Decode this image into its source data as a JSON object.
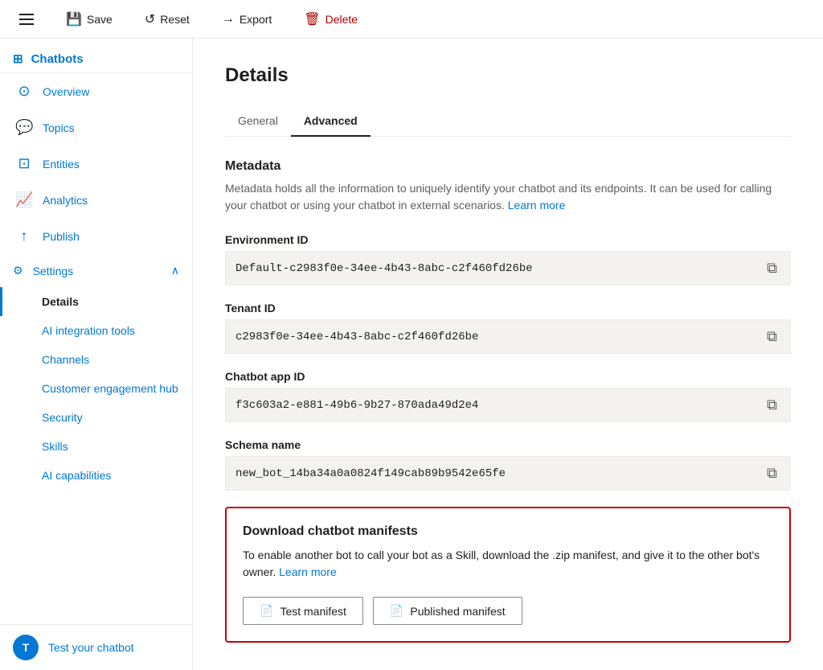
{
  "toolbar": {
    "save_label": "Save",
    "reset_label": "Reset",
    "export_label": "Export",
    "delete_label": "Delete"
  },
  "sidebar": {
    "app_name": "Chatbots",
    "items": [
      {
        "id": "chatbots",
        "label": "Chatbots",
        "icon": "⊞"
      },
      {
        "id": "overview",
        "label": "Overview",
        "icon": "⊙"
      },
      {
        "id": "topics",
        "label": "Topics",
        "icon": "💬"
      },
      {
        "id": "entities",
        "label": "Entities",
        "icon": "⊡"
      },
      {
        "id": "analytics",
        "label": "Analytics",
        "icon": "📈"
      },
      {
        "id": "publish",
        "label": "Publish",
        "icon": "↑"
      }
    ],
    "settings_label": "Settings",
    "settings_icon": "⚙",
    "sub_items": [
      {
        "id": "details",
        "label": "Details"
      },
      {
        "id": "ai-integration",
        "label": "AI integration tools"
      },
      {
        "id": "channels",
        "label": "Channels"
      },
      {
        "id": "customer-engagement",
        "label": "Customer engagement hub"
      },
      {
        "id": "security",
        "label": "Security"
      },
      {
        "id": "skills",
        "label": "Skills"
      },
      {
        "id": "ai-capabilities",
        "label": "AI capabilities"
      }
    ],
    "bottom_item": "Test your chatbot",
    "avatar_initials": "T"
  },
  "page": {
    "title": "Details",
    "tabs": [
      {
        "id": "general",
        "label": "General"
      },
      {
        "id": "advanced",
        "label": "Advanced"
      }
    ],
    "active_tab": "advanced"
  },
  "metadata": {
    "title": "Metadata",
    "description": "Metadata holds all the information to uniquely identify your chatbot and its endpoints. It can be used for calling your chatbot or using your chatbot in external scenarios.",
    "learn_more_link": "Learn more",
    "fields": [
      {
        "id": "environment-id",
        "label": "Environment ID",
        "value": "Default-c2983f0e-34ee-4b43-8abc-c2f460fd26be"
      },
      {
        "id": "tenant-id",
        "label": "Tenant ID",
        "value": "c2983f0e-34ee-4b43-8abc-c2f460fd26be"
      },
      {
        "id": "chatbot-app-id",
        "label": "Chatbot app ID",
        "value": "f3c603a2-e881-49b6-9b27-870ada49d2e4"
      },
      {
        "id": "schema-name",
        "label": "Schema name",
        "value": "new_bot_14ba34a0a0824f149cab89b9542e65fe"
      }
    ]
  },
  "download": {
    "title": "Download chatbot manifests",
    "description": "To enable another bot to call your bot as a Skill, download the .zip manifest, and give it to the other bot's owner.",
    "learn_more_link": "Learn more",
    "buttons": [
      {
        "id": "test-manifest",
        "label": "Test manifest"
      },
      {
        "id": "published-manifest",
        "label": "Published manifest"
      }
    ]
  }
}
